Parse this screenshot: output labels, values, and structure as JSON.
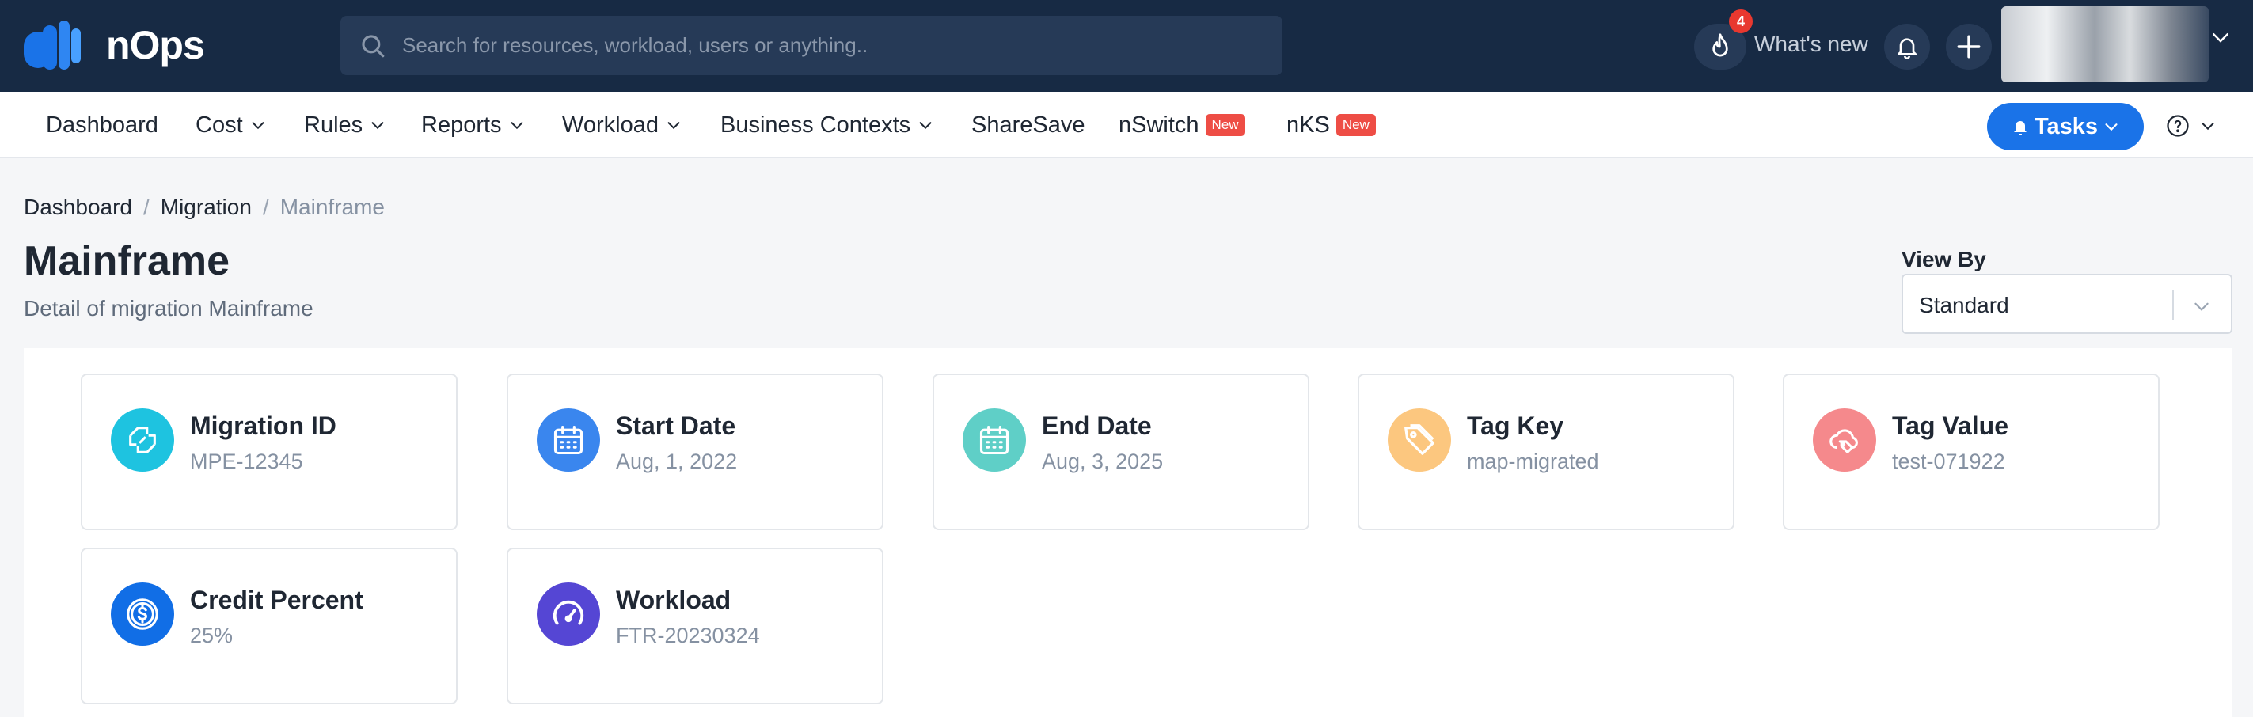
{
  "app": {
    "name": "nOps"
  },
  "search": {
    "placeholder": "Search for resources, workload, users or anything.."
  },
  "header": {
    "notification_count": "4",
    "whats_new_label": "What's new"
  },
  "nav": {
    "items": [
      {
        "label": "Dashboard"
      },
      {
        "label": "Cost"
      },
      {
        "label": "Rules"
      },
      {
        "label": "Reports"
      },
      {
        "label": "Workload"
      },
      {
        "label": "Business Contexts"
      },
      {
        "label": "ShareSave"
      },
      {
        "label": "nSwitch",
        "badge": "New"
      },
      {
        "label": "nKS",
        "badge": "New"
      }
    ],
    "tasks_label": "Tasks"
  },
  "breadcrumb": [
    {
      "label": "Dashboard"
    },
    {
      "label": "Migration"
    },
    {
      "label": "Mainframe"
    }
  ],
  "page": {
    "title": "Mainframe",
    "subtitle": "Detail of migration Mainframe"
  },
  "view_by": {
    "label": "View By",
    "selected": "Standard"
  },
  "cards": [
    {
      "title": "Migration ID",
      "value": "MPE-12345",
      "icon": "migration-icon",
      "color": "#1ec3e0"
    },
    {
      "title": "Start Date",
      "value": "Aug, 1, 2022",
      "icon": "calendar-icon",
      "color": "#3a86ee"
    },
    {
      "title": "End Date",
      "value": "Aug, 3, 2025",
      "icon": "calendar-icon",
      "color": "#5fcfc7"
    },
    {
      "title": "Tag Key",
      "value": "map-migrated",
      "icon": "tag-icon",
      "color": "#fcc77f"
    },
    {
      "title": "Tag Value",
      "value": "test-071922",
      "icon": "cloud-tag-icon",
      "color": "#f5898c"
    },
    {
      "title": "Credit Percent",
      "value": "25%",
      "icon": "dollar-coin-icon",
      "color": "#116ee6"
    },
    {
      "title": "Workload",
      "value": "FTR-20230324",
      "icon": "gauge-icon",
      "color": "#5546d4"
    }
  ],
  "colors": {
    "topbar": "#172a44",
    "accent": "#1a73e8",
    "badge": "#ee4d45"
  }
}
